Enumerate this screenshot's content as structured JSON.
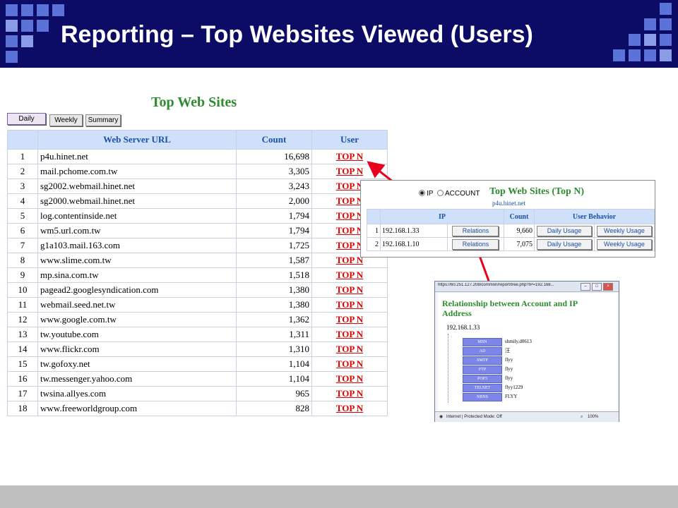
{
  "slide": {
    "title": "Reporting – Top Websites Viewed (Users)"
  },
  "report": {
    "title": "Top Web Sites",
    "buttons": {
      "daily": "Daily",
      "weekly": "Weekly",
      "summary": "Summary"
    },
    "columns": {
      "url": "Web Server URL",
      "count": "Count",
      "user": "User"
    },
    "rows": [
      {
        "n": "1",
        "url": "p4u.hinet.net",
        "count": "16,698",
        "user": "TOP N"
      },
      {
        "n": "2",
        "url": "mail.pchome.com.tw",
        "count": "3,305",
        "user": "TOP N"
      },
      {
        "n": "3",
        "url": "sg2002.webmail.hinet.net",
        "count": "3,243",
        "user": "TOP N"
      },
      {
        "n": "4",
        "url": "sg2000.webmail.hinet.net",
        "count": "2,000",
        "user": "TOP N"
      },
      {
        "n": "5",
        "url": "log.contentinside.net",
        "count": "1,794",
        "user": "TOP N"
      },
      {
        "n": "6",
        "url": "wm5.url.com.tw",
        "count": "1,794",
        "user": "TOP N"
      },
      {
        "n": "7",
        "url": "g1a103.mail.163.com",
        "count": "1,725",
        "user": "TOP N"
      },
      {
        "n": "8",
        "url": "www.slime.com.tw",
        "count": "1,587",
        "user": "TOP N"
      },
      {
        "n": "9",
        "url": "mp.sina.com.tw",
        "count": "1,518",
        "user": "TOP N"
      },
      {
        "n": "10",
        "url": "pagead2.googlesyndication.com",
        "count": "1,380",
        "user": "TOP N"
      },
      {
        "n": "11",
        "url": "webmail.seed.net.tw",
        "count": "1,380",
        "user": "TOP N"
      },
      {
        "n": "12",
        "url": "www.google.com.tw",
        "count": "1,362",
        "user": "TOP N"
      },
      {
        "n": "13",
        "url": "tw.youtube.com",
        "count": "1,311",
        "user": "TOP N"
      },
      {
        "n": "14",
        "url": "www.flickr.com",
        "count": "1,310",
        "user": "TOP N"
      },
      {
        "n": "15",
        "url": "tw.gofoxy.net",
        "count": "1,104",
        "user": "TOP N"
      },
      {
        "n": "16",
        "url": "tw.messenger.yahoo.com",
        "count": "1,104",
        "user": "TOP N"
      },
      {
        "n": "17",
        "url": "twsina.allyes.com",
        "count": "965",
        "user": "TOP N"
      },
      {
        "n": "18",
        "url": "www.freeworldgroup.com",
        "count": "828",
        "user": "TOP N"
      }
    ]
  },
  "topn": {
    "radio_ip": "IP",
    "radio_account": "ACCOUNT",
    "title": "Top Web Sites (Top N)",
    "subtitle": "p4u.hinet.net",
    "columns": {
      "ip": "IP",
      "count": "Count",
      "behavior": "User Behavior"
    },
    "rows": [
      {
        "n": "1",
        "ip": "192.168.1.33",
        "relations": "Relations",
        "count": "9,660",
        "daily": "Daily Usage",
        "weekly": "Weekly Usage"
      },
      {
        "n": "2",
        "ip": "192.168.1.10",
        "relations": "Relations",
        "count": "7,075",
        "daily": "Daily Usage",
        "weekly": "Weekly Usage"
      }
    ]
  },
  "relwin": {
    "url": "https://60.251.127.208/common/report/tree.php?IP=192.168...",
    "heading": "Relationship between Account and IP Address",
    "ip": "192.168.1.33",
    "items": [
      {
        "proto": "MSN",
        "value": "shmily.d0613"
      },
      {
        "proto": "AD",
        "value": "汪"
      },
      {
        "proto": "SMTP",
        "value": "flyy"
      },
      {
        "proto": "FTP",
        "value": "flyy"
      },
      {
        "proto": "POP3",
        "value": "flyy"
      },
      {
        "proto": "TELNET",
        "value": "flyy1229"
      },
      {
        "proto": "NBNS",
        "value": "FLYY"
      }
    ],
    "status": "Internet | Protected Mode: Off",
    "zoom": "100%"
  },
  "colors": {
    "title_bar": "#0c0c66",
    "report_title": "#2e8b2e",
    "header_fill": "#cfe0fb",
    "topn_link": "#e00000",
    "arrow": "#e8001c"
  }
}
